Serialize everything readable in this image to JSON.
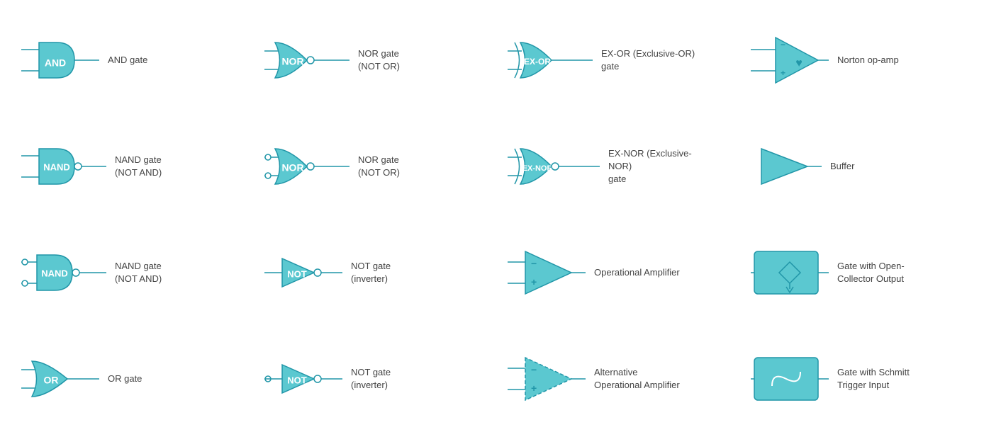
{
  "colors": {
    "fill": "#5bc8d0",
    "stroke": "#2196a8",
    "bg": "#ffffff"
  },
  "cells": [
    {
      "id": "and-gate",
      "label": "AND gate",
      "symbol": "and"
    },
    {
      "id": "nor-gate-1",
      "label": "NOR gate\n(NOT OR)",
      "symbol": "nor"
    },
    {
      "id": "exor-gate",
      "label": "EX-OR (Exclusive-OR)\ngate",
      "symbol": "exor"
    },
    {
      "id": "norton-opamp",
      "label": "Norton op-amp",
      "symbol": "norton"
    },
    {
      "id": "nand-gate-1",
      "label": "NAND gate\n(NOT AND)",
      "symbol": "nand"
    },
    {
      "id": "nor-gate-2",
      "label": "NOR gate\n(NOT OR)",
      "symbol": "nor2"
    },
    {
      "id": "exnor-gate",
      "label": "EX-NOR (Exclusive-NOR)\ngate",
      "symbol": "exnor"
    },
    {
      "id": "buffer",
      "label": "Buffer",
      "symbol": "buffer"
    },
    {
      "id": "nand-gate-2",
      "label": "NAND gate\n(NOT AND)",
      "symbol": "nand2"
    },
    {
      "id": "not-gate-1",
      "label": "NOT gate\n(inverter)",
      "symbol": "not1"
    },
    {
      "id": "opamp",
      "label": "Operational Amplifier",
      "symbol": "opamp"
    },
    {
      "id": "opencollector",
      "label": "Gate with Open-\nCollector Output",
      "symbol": "opencollector"
    },
    {
      "id": "or-gate",
      "label": "OR gate",
      "symbol": "or"
    },
    {
      "id": "not-gate-2",
      "label": "NOT gate\n(inverter)",
      "symbol": "not2"
    },
    {
      "id": "alt-opamp",
      "label": "Alternative\nOperational Amplifier",
      "symbol": "altopamp"
    },
    {
      "id": "schmitt",
      "label": "Gate with Schmitt\nTrigger Input",
      "symbol": "schmitt"
    }
  ]
}
